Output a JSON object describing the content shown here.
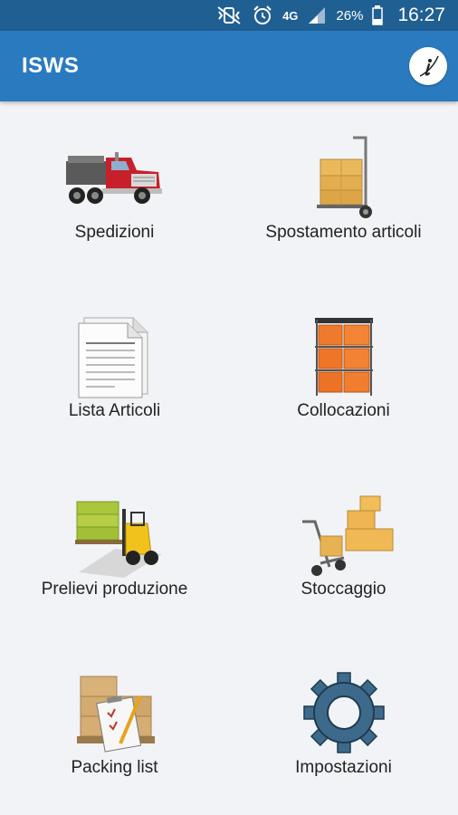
{
  "status_bar": {
    "network": "4G",
    "battery": "26%",
    "time": "16:27"
  },
  "app_bar": {
    "title": "ISWS",
    "info_icon": "info-icon"
  },
  "menu": {
    "items": [
      {
        "label": "Spedizioni",
        "icon": "truck-icon"
      },
      {
        "label": "Spostamento articoli",
        "icon": "hand-truck-icon"
      },
      {
        "label": "Lista Articoli",
        "icon": "document-list-icon"
      },
      {
        "label": "Collocazioni",
        "icon": "shelf-boxes-icon"
      },
      {
        "label": "Prelievi produzione",
        "icon": "forklift-icon"
      },
      {
        "label": "Stoccaggio",
        "icon": "boxes-cart-icon"
      },
      {
        "label": "Packing list",
        "icon": "clipboard-pallet-icon"
      },
      {
        "label": "Impostazioni",
        "icon": "gear-icon"
      }
    ]
  }
}
